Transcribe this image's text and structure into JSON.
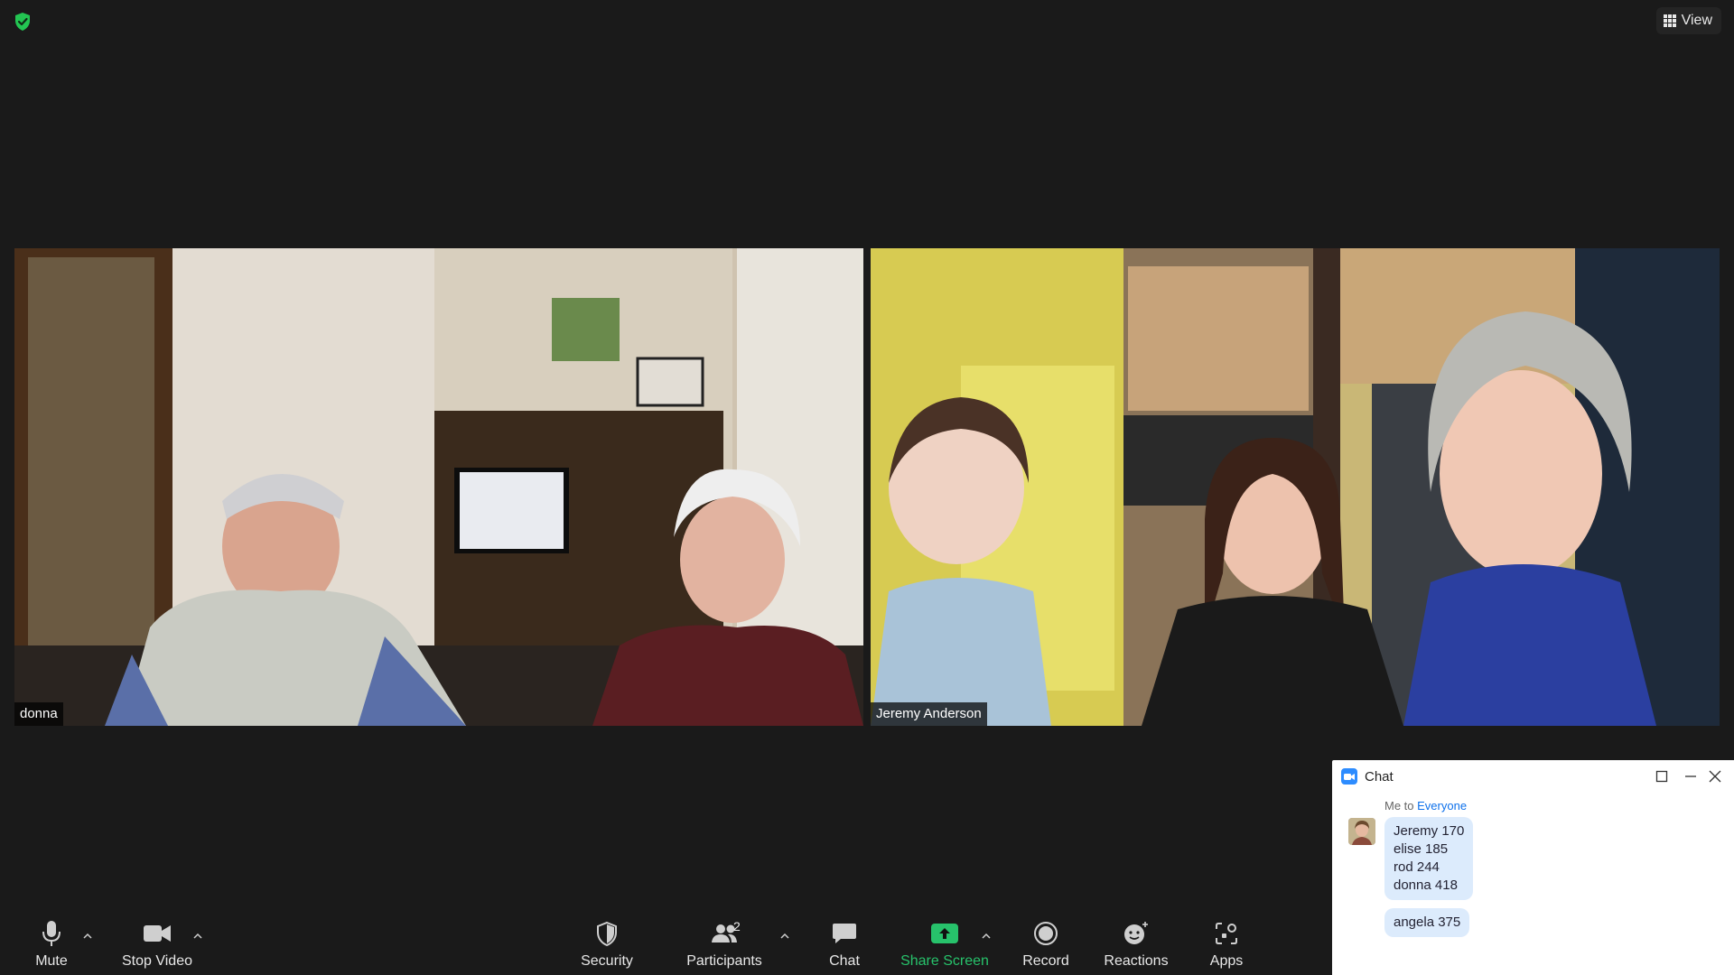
{
  "window": {
    "view_label": "View",
    "encryption_icon": "shield-check-icon"
  },
  "videos": [
    {
      "name": "donna"
    },
    {
      "name": "Jeremy Anderson"
    }
  ],
  "chat": {
    "title": "Chat",
    "from": "Me to ",
    "to": "Everyone",
    "messages": [
      {
        "lines": [
          "Jeremy 170",
          "elise 185",
          "rod 244",
          "donna 418"
        ]
      },
      {
        "lines": [
          "angela 375"
        ]
      }
    ]
  },
  "toolbar": {
    "mute": "Mute",
    "stop_video": "Stop Video",
    "security": "Security",
    "participants": "Participants",
    "participants_count": "2",
    "chat": "Chat",
    "share_screen": "Share Screen",
    "record": "Record",
    "reactions": "Reactions",
    "apps": "Apps"
  },
  "colors": {
    "background": "#1a1a1a",
    "share_green": "#27c26b",
    "zoom_blue": "#2d8cff",
    "chat_bubble": "#dcebfc"
  }
}
